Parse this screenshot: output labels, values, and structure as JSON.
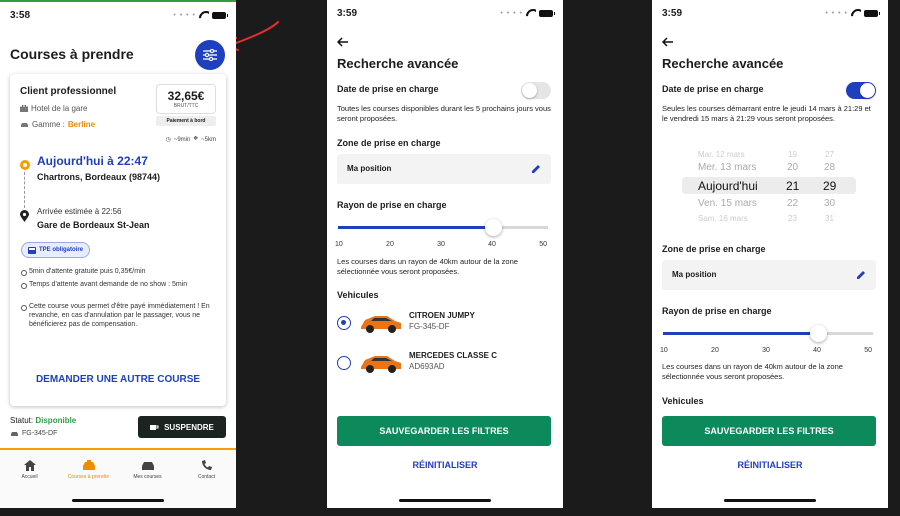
{
  "colors": {
    "brand_blue": "#1f3fbf",
    "green": "#0d8a5c",
    "orange": "#f59f00",
    "status_green": "#2f9e44"
  },
  "screen1": {
    "time": "3:58",
    "title": "Courses à prendre",
    "card": {
      "client": "Client professionnel",
      "place": "Hotel de la gare",
      "gamme_label": "Gamme :",
      "gamme_value": "Berline",
      "price": "32,65€",
      "price_sub": "BRUT/TTC",
      "payment": "Paiement à bord",
      "duration": "~9min",
      "distance": "~5km",
      "departure_time": "Aujourd'hui à 22:47",
      "departure_address": "Chartrons, Bordeaux (98744)",
      "arrival_estimate": "Arrivée estimée à 22:56",
      "arrival_address": "Gare de Bordeaux St-Jean",
      "tpe_badge": "TPE obligatoire",
      "bullets": [
        "5min d'attente gratuite puis 0,35€/min",
        "Temps d'attente avant demande de no show : 5min",
        "Cette course vous permet d'être payé immédiatement ! En revanche, en cas d'annulation par le passager, vous ne bénéficierez pas de compensation."
      ],
      "other_course": "DEMANDER UNE AUTRE COURSE"
    },
    "status_label": "Statut:",
    "status_value": "Disponible",
    "plate": "FG-345-DF",
    "suspend": "SUSPENDRE",
    "tabs": [
      {
        "label": "Accueil",
        "icon": "home-icon"
      },
      {
        "label": "Courses à prendre",
        "icon": "taxi-icon"
      },
      {
        "label": "Mes courses",
        "icon": "car-icon"
      },
      {
        "label": "Contact",
        "icon": "phone-icon"
      }
    ]
  },
  "screen2": {
    "time": "3:59",
    "title": "Recherche avancée",
    "date_label": "Date de prise en charge",
    "date_toggle_on": false,
    "date_desc": "Toutes les courses disponibles durant les 5 prochains jours vous seront proposées.",
    "zone_label": "Zone de prise en charge",
    "zone_value": "Ma position",
    "radius_label": "Rayon de prise en charge",
    "radius_value_km": 40,
    "ticks": [
      "10",
      "20",
      "30",
      "40",
      "50"
    ],
    "radius_desc": "Les courses dans un rayon de 40km autour de la zone sélectionnée vous seront proposées.",
    "vehicles_label": "Vehicules",
    "vehicles": [
      {
        "name": "CITROEN JUMPY",
        "plate": "FG-345-DF",
        "selected": true
      },
      {
        "name": "MERCEDES CLASSE C",
        "plate": "AD693AD",
        "selected": false
      }
    ],
    "save": "SAUVEGARDER LES FILTRES",
    "reset": "RÉINITIALISER"
  },
  "screen3": {
    "time": "3:59",
    "title": "Recherche avancée",
    "date_label": "Date de prise en charge",
    "date_toggle_on": true,
    "date_desc": "Seules les courses démarrant entre le jeudi 14 mars à 21:29 et le vendredi 15 mars à 21:29 vous seront proposées.",
    "picker": {
      "rows": [
        {
          "day": "Mar. 12 mars",
          "hour": "19",
          "min": "27"
        },
        {
          "day": "Mer. 13 mars",
          "hour": "20",
          "min": "28"
        },
        {
          "day": "Aujourd'hui",
          "hour": "21",
          "min": "29"
        },
        {
          "day": "Ven. 15 mars",
          "hour": "22",
          "min": "30"
        },
        {
          "day": "Sam. 16 mars",
          "hour": "23",
          "min": "31"
        }
      ]
    },
    "zone_label": "Zone de prise en charge",
    "zone_value": "Ma position",
    "radius_label": "Rayon de prise en charge",
    "radius_value_km": 40,
    "ticks": [
      "10",
      "20",
      "30",
      "40",
      "50"
    ],
    "radius_desc": "Les courses dans un rayon de 40km autour de la zone sélectionnée vous seront proposées.",
    "vehicles_label": "Vehicules",
    "save": "SAUVEGARDER LES FILTRES",
    "reset": "RÉINITIALISER"
  }
}
